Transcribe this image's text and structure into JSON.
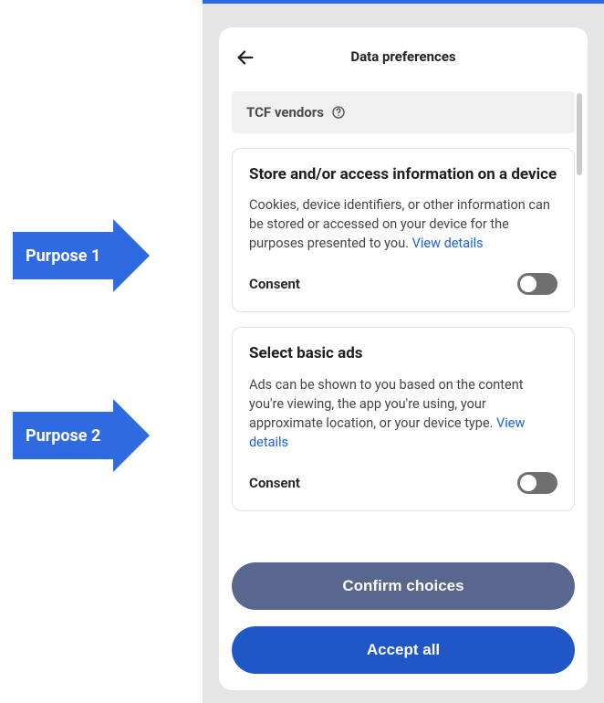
{
  "annotations": {
    "purpose1_label": "Purpose 1",
    "purpose2_label": "Purpose 2"
  },
  "modal": {
    "title": "Data preferences",
    "vendors_label": "TCF vendors",
    "purposes": [
      {
        "title": "Store and/or access information on a device",
        "description": "Cookies, device identifiers, or other information can be stored or accessed on your device for the purposes presented to you. ",
        "view_details": "View details",
        "consent_label": "Consent"
      },
      {
        "title": "Select basic ads",
        "description": "Ads can be shown to you based on the content you're viewing, the app you're using, your approximate location, or your device type. ",
        "view_details": "View details",
        "consent_label": "Consent"
      }
    ],
    "confirm_label": "Confirm choices",
    "accept_label": "Accept all"
  }
}
